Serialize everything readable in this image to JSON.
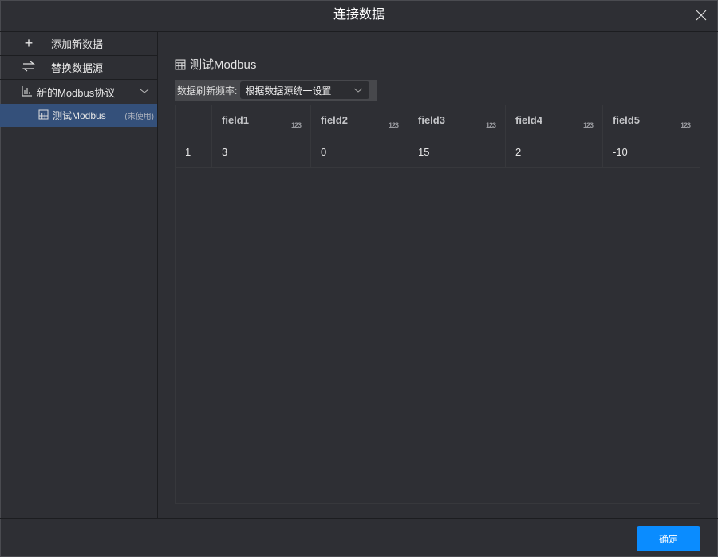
{
  "dialog": {
    "title": "连接数据"
  },
  "sidebar": {
    "add_label": "添加新数据",
    "replace_label": "替换数据源",
    "group_label": "新的Modbus协议",
    "item_label": "测试Modbus",
    "item_status": "(未使用)"
  },
  "main": {
    "title": "测试Modbus",
    "refresh_label": "数据刷新频率:",
    "refresh_value": "根据数据源统一设置"
  },
  "table": {
    "type_badge": "123",
    "columns": [
      "field1",
      "field2",
      "field3",
      "field4",
      "field5"
    ],
    "rows": [
      {
        "index": "1",
        "values": [
          "3",
          "0",
          "15",
          "2",
          "-10"
        ]
      }
    ]
  },
  "footer": {
    "confirm_label": "确定"
  },
  "colors": {
    "accent": "#0a8cff",
    "selected": "#34507a",
    "background": "#2e2f34"
  }
}
